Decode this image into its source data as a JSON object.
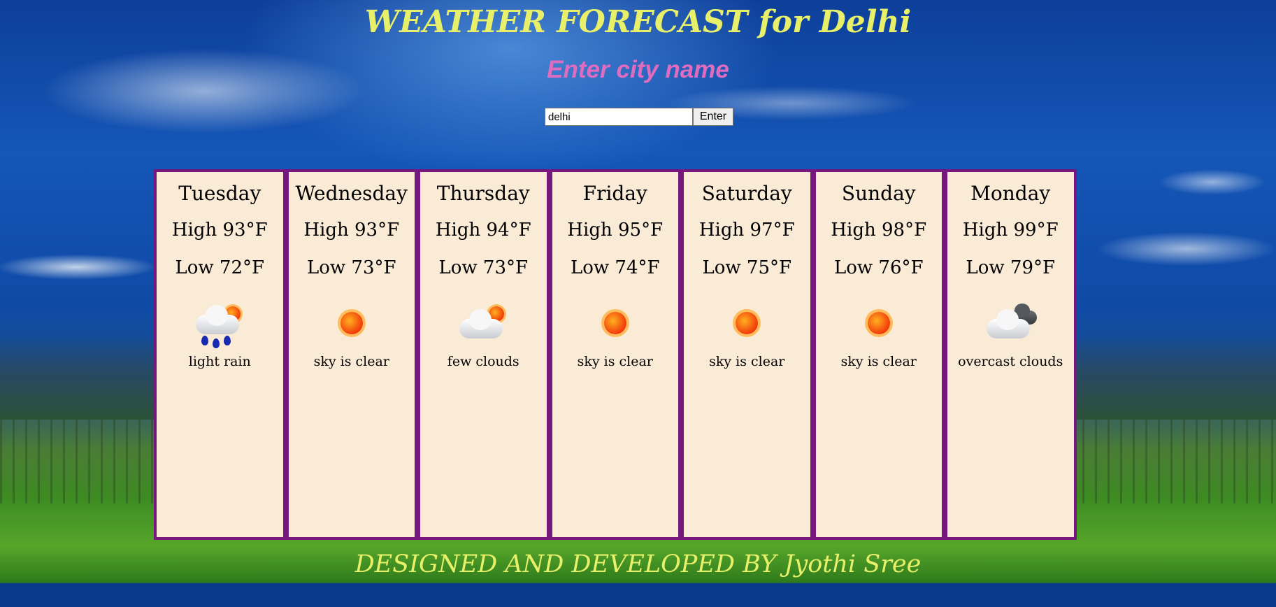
{
  "header": {
    "title": "WEATHER FORECAST for Delhi",
    "subtitle": "Enter city name"
  },
  "search": {
    "value": "delhi",
    "button_label": "Enter"
  },
  "forecast": [
    {
      "day": "Tuesday",
      "high": "High 93°F",
      "low": "Low 72°F",
      "icon": "light-rain-sun-icon",
      "desc": "light rain"
    },
    {
      "day": "Wednesday",
      "high": "High 93°F",
      "low": "Low 73°F",
      "icon": "sun-icon",
      "desc": "sky is clear"
    },
    {
      "day": "Thursday",
      "high": "High 94°F",
      "low": "Low 73°F",
      "icon": "few-clouds-icon",
      "desc": "few clouds"
    },
    {
      "day": "Friday",
      "high": "High 95°F",
      "low": "Low 74°F",
      "icon": "sun-icon",
      "desc": "sky is clear"
    },
    {
      "day": "Saturday",
      "high": "High 97°F",
      "low": "Low 75°F",
      "icon": "sun-icon",
      "desc": "sky is clear"
    },
    {
      "day": "Sunday",
      "high": "High 98°F",
      "low": "Low 76°F",
      "icon": "sun-icon",
      "desc": "sky is clear"
    },
    {
      "day": "Monday",
      "high": "High 99°F",
      "low": "Low 79°F",
      "icon": "overcast-clouds-icon",
      "desc": "overcast clouds"
    }
  ],
  "footer": {
    "credit": "DESIGNED AND DEVELOPED BY Jyothi Sree"
  },
  "colors": {
    "card_bg": "#faebd7",
    "card_border": "#76177d",
    "title": "#e8f06a",
    "subtitle": "#e06cc0"
  }
}
